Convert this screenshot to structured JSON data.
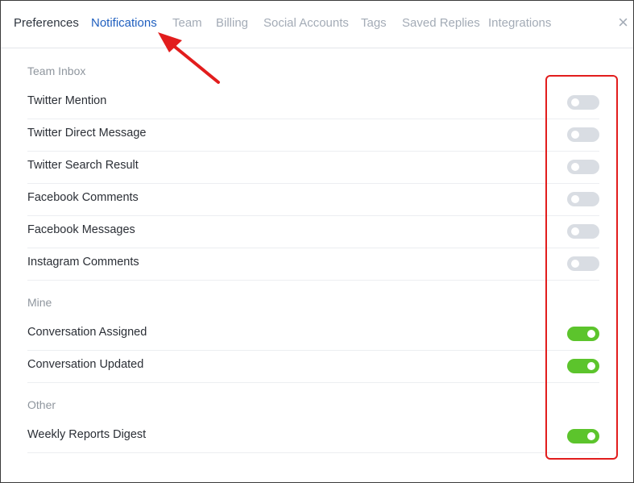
{
  "tabs": [
    {
      "label": "Preferences"
    },
    {
      "label": "Notifications"
    },
    {
      "label": "Team"
    },
    {
      "label": "Billing"
    },
    {
      "label": "Social Accounts"
    },
    {
      "label": "Tags"
    },
    {
      "label": "Saved Replies"
    },
    {
      "label": "Integrations"
    }
  ],
  "close_icon": "×",
  "sections": {
    "team_inbox": {
      "title": "Team Inbox",
      "items": [
        {
          "label": "Twitter Mention",
          "enabled": false
        },
        {
          "label": "Twitter Direct Message",
          "enabled": false
        },
        {
          "label": "Twitter Search Result",
          "enabled": false
        },
        {
          "label": "Facebook Comments",
          "enabled": false
        },
        {
          "label": "Facebook Messages",
          "enabled": false
        },
        {
          "label": "Instagram Comments",
          "enabled": false
        }
      ]
    },
    "mine": {
      "title": "Mine",
      "items": [
        {
          "label": "Conversation Assigned",
          "enabled": true
        },
        {
          "label": "Conversation Updated",
          "enabled": true
        }
      ]
    },
    "other": {
      "title": "Other",
      "items": [
        {
          "label": "Weekly Reports Digest",
          "enabled": true
        }
      ]
    }
  },
  "colors": {
    "accent": "#1f5fbf",
    "toggle_on": "#5cc42c",
    "toggle_off": "#d9dde3",
    "annotation": "#e21d1d"
  }
}
